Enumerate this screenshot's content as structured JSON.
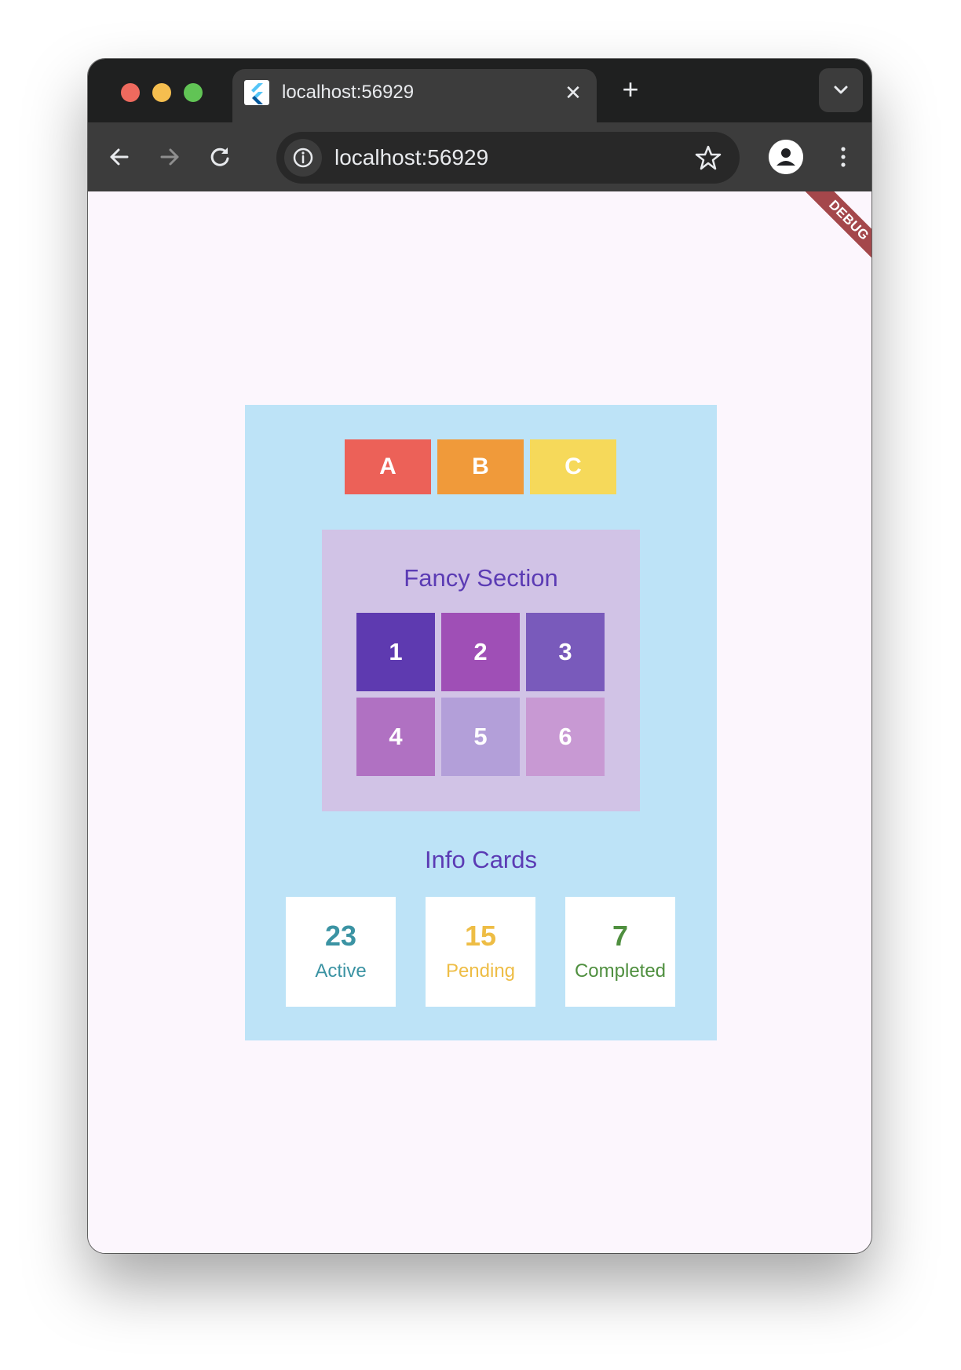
{
  "browser": {
    "tab": {
      "title": "localhost:56929",
      "close_label": "✕"
    },
    "new_tab_label": "+",
    "omnibox": {
      "url": "localhost:56929"
    }
  },
  "app": {
    "debug_banner": "DEBUG",
    "letters": [
      {
        "label": "A",
        "color": "#ec6158"
      },
      {
        "label": "B",
        "color": "#f09a3a"
      },
      {
        "label": "C",
        "color": "#f6d95a"
      }
    ],
    "fancy_section": {
      "title": "Fancy Section",
      "cells": [
        {
          "label": "1",
          "color": "#5e3ab0"
        },
        {
          "label": "2",
          "color": "#9f4fb6"
        },
        {
          "label": "3",
          "color": "#795abb"
        },
        {
          "label": "4",
          "color": "#b071c2"
        },
        {
          "label": "5",
          "color": "#b39fd9"
        },
        {
          "label": "6",
          "color": "#c899d3"
        }
      ]
    },
    "info_cards": {
      "title": "Info Cards",
      "cards": [
        {
          "value": "23",
          "label": "Active",
          "color": "#3b93a3"
        },
        {
          "value": "15",
          "label": "Pending",
          "color": "#eebd45"
        },
        {
          "value": "7",
          "label": "Completed",
          "color": "#4f8f3f"
        }
      ]
    }
  }
}
